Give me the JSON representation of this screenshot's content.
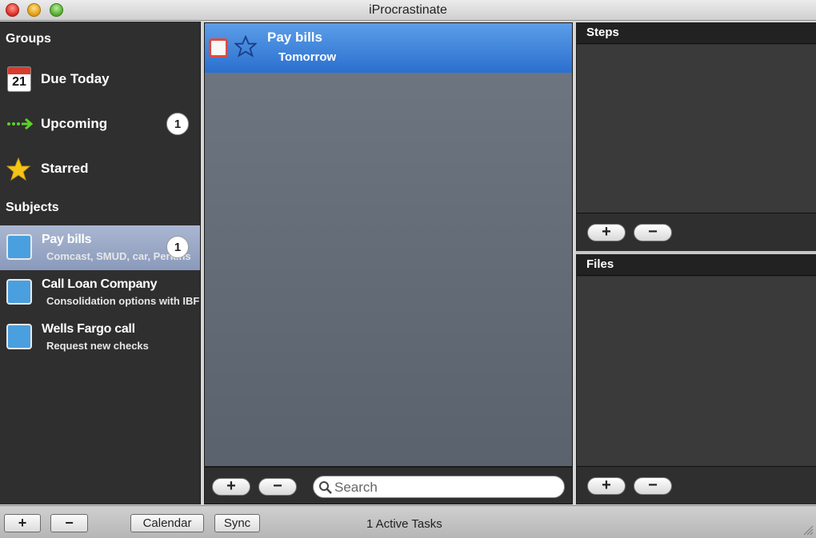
{
  "window": {
    "title": "iProcrastinate"
  },
  "sidebar": {
    "groups_header": "Groups",
    "groups": [
      {
        "label": "Due Today",
        "icon": "calendar-icon",
        "icon_text": "21"
      },
      {
        "label": "Upcoming",
        "icon": "arrow-icon",
        "badge": "1"
      },
      {
        "label": "Starred",
        "icon": "star-icon"
      }
    ],
    "subjects_header": "Subjects",
    "subjects": [
      {
        "title": "Pay bills",
        "subtitle": "Comcast, SMUD, car, Perkins",
        "badge": "1",
        "selected": true
      },
      {
        "title": "Call Loan Company",
        "subtitle": "Consolidation options with IBF"
      },
      {
        "title": "Wells Fargo call",
        "subtitle": "Request new checks"
      }
    ]
  },
  "tasks": [
    {
      "title": "Pay bills",
      "due": "Tomorrow"
    }
  ],
  "middle_toolbar": {
    "add_label": "+",
    "remove_label": "−",
    "search_placeholder": "Search"
  },
  "steps": {
    "header": "Steps",
    "add_label": "+",
    "remove_label": "−"
  },
  "files": {
    "header": "Files",
    "add_label": "+",
    "remove_label": "−"
  },
  "bottombar": {
    "add_label": "+",
    "remove_label": "−",
    "calendar_label": "Calendar",
    "sync_label": "Sync",
    "status": "1 Active Tasks"
  },
  "colors": {
    "sidebar_bg": "#2f2f2f",
    "selection": "#8a9abb",
    "task_selection": "#2a6fcf",
    "subject_color": "#4a9fdf"
  }
}
